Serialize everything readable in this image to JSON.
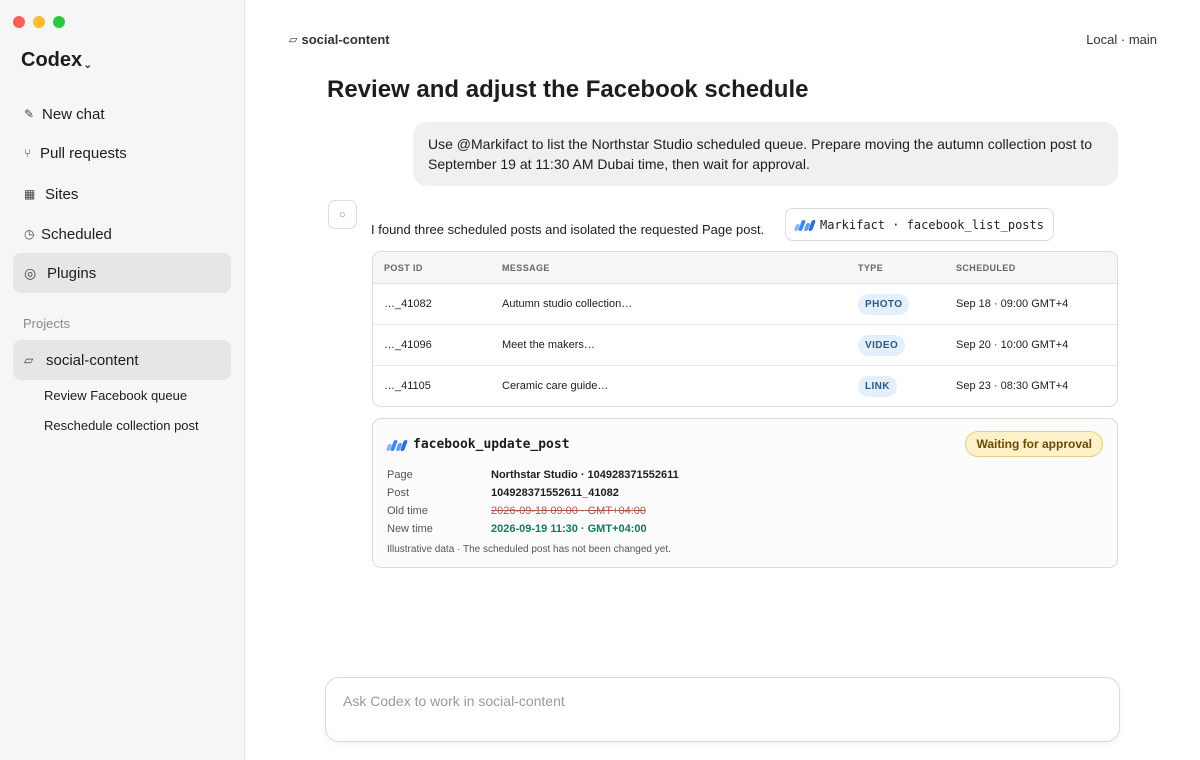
{
  "sidebar": {
    "brand": "Codex",
    "nav": [
      {
        "label": "New chat",
        "icon": "pencil-icon"
      },
      {
        "label": "Pull requests",
        "icon": "branch-icon"
      },
      {
        "label": "Sites",
        "icon": "grid-icon"
      },
      {
        "label": "Scheduled",
        "icon": "clock-icon"
      },
      {
        "label": "Plugins",
        "icon": "plugin-icon"
      }
    ],
    "projects_label": "Projects",
    "project": {
      "label": "social-content",
      "icon": "folder-icon"
    },
    "threads": [
      "Review Facebook queue",
      "Reschedule collection post"
    ]
  },
  "header": {
    "breadcrumb": "social-content",
    "environment": "Local · main"
  },
  "conversation": {
    "title": "Review and adjust the Facebook schedule",
    "user_message": "Use @Markifact to list the Northstar Studio scheduled queue. Prepare moving the autumn collection post to September 19 at 11:30 AM Dubai time, then wait for approval.",
    "assistant_text": "I found three scheduled posts and isolated the requested Page post.",
    "tool_call": "Markifact · facebook_list_posts"
  },
  "posts_table": {
    "headers": [
      "POST ID",
      "MESSAGE",
      "TYPE",
      "SCHEDULED"
    ],
    "rows": [
      {
        "post_id": "…_41082",
        "message": "Autumn studio collection…",
        "type": "PHOTO",
        "scheduled": "Sep 18 · 09:00 GMT+4"
      },
      {
        "post_id": "…_41096",
        "message": "Meet the makers…",
        "type": "VIDEO",
        "scheduled": "Sep 20 · 10:00 GMT+4"
      },
      {
        "post_id": "…_41105",
        "message": "Ceramic care guide…",
        "type": "LINK",
        "scheduled": "Sep 23 · 08:30 GMT+4"
      }
    ]
  },
  "update_card": {
    "tool": "facebook_update_post",
    "status": "Waiting for approval",
    "fields": [
      {
        "label": "Page",
        "value": "Northstar Studio · 104928371552611"
      },
      {
        "label": "Post",
        "value": "104928371552611_41082"
      },
      {
        "label": "Old time",
        "value": "2026-09-18 09:00 · GMT+04:00"
      },
      {
        "label": "New time",
        "value": "2026-09-19 11:30 · GMT+04:00"
      }
    ],
    "note": "Illustrative data · The scheduled post has not been changed yet."
  },
  "composer": {
    "placeholder": "Ask Codex to work in social-content"
  },
  "colors": {
    "accent_new_time": "#15795a",
    "old_time": "#b0584a",
    "status_bg": "#fdf1c9",
    "badge_bg": "#e3effb"
  }
}
